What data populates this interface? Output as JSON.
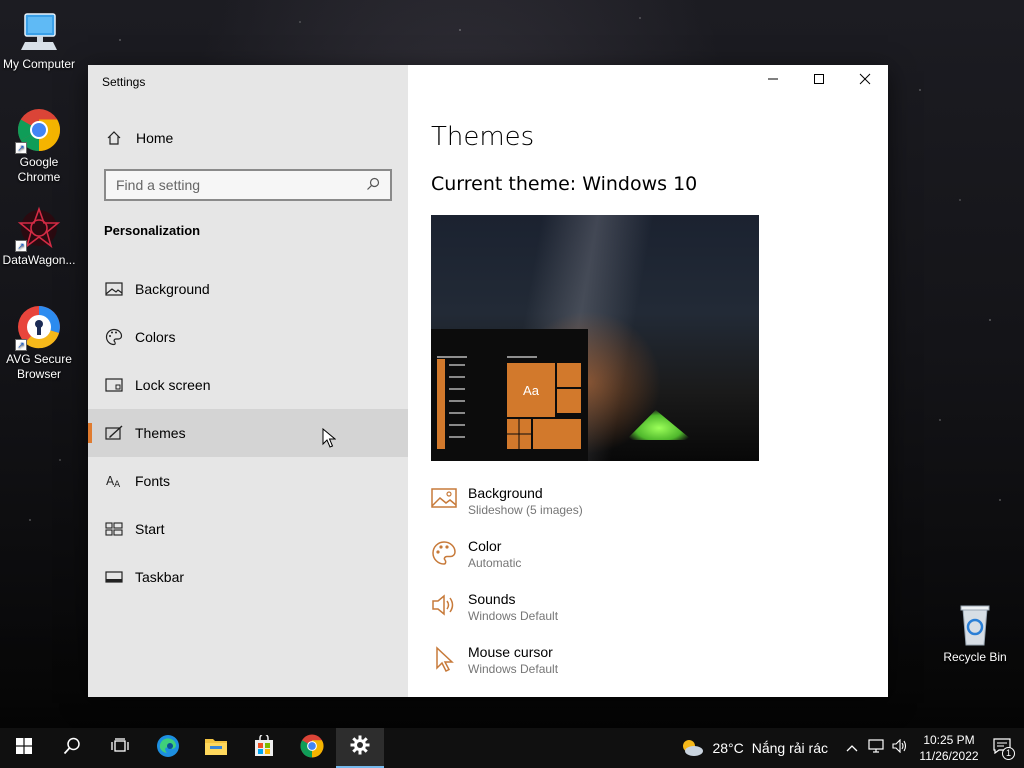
{
  "desktop": {
    "icons": [
      {
        "label": "My Computer"
      },
      {
        "label": "Google Chrome"
      },
      {
        "label": "DataWagon..."
      },
      {
        "label": "AVG Secure Browser"
      },
      {
        "label": "Recycle Bin"
      }
    ]
  },
  "window": {
    "title": "Settings",
    "controls": {
      "minimize": "minimize-icon",
      "maximize": "maximize-icon",
      "close": "close-icon"
    }
  },
  "sidebar": {
    "home_label": "Home",
    "search_placeholder": "Find a setting",
    "section_title": "Personalization",
    "items": [
      {
        "label": "Background",
        "icon": "picture-icon"
      },
      {
        "label": "Colors",
        "icon": "palette-icon"
      },
      {
        "label": "Lock screen",
        "icon": "lock-screen-icon"
      },
      {
        "label": "Themes",
        "icon": "brush-icon",
        "active": true
      },
      {
        "label": "Fonts",
        "icon": "font-icon"
      },
      {
        "label": "Start",
        "icon": "start-icon"
      },
      {
        "label": "Taskbar",
        "icon": "taskbar-icon"
      }
    ]
  },
  "content": {
    "title": "Themes",
    "current_theme": "Current theme: Windows 10",
    "preview_tile_label": "Aa",
    "properties": [
      {
        "name": "Background",
        "value": "Slideshow (5 images)",
        "icon": "picture-icon"
      },
      {
        "name": "Color",
        "value": "Automatic",
        "icon": "palette-icon"
      },
      {
        "name": "Sounds",
        "value": "Windows Default",
        "icon": "speaker-icon"
      },
      {
        "name": "Mouse cursor",
        "value": "Windows Default",
        "icon": "cursor-icon"
      }
    ]
  },
  "taskbar": {
    "weather": {
      "temp": "28°C",
      "text": "Nắng rải rác"
    },
    "clock": {
      "time": "10:25 PM",
      "date": "11/26/2022"
    },
    "notification_count": "1",
    "accent": "#76b9ed"
  },
  "colors": {
    "accent": "#e07b2f",
    "tile": "#d2792c"
  }
}
